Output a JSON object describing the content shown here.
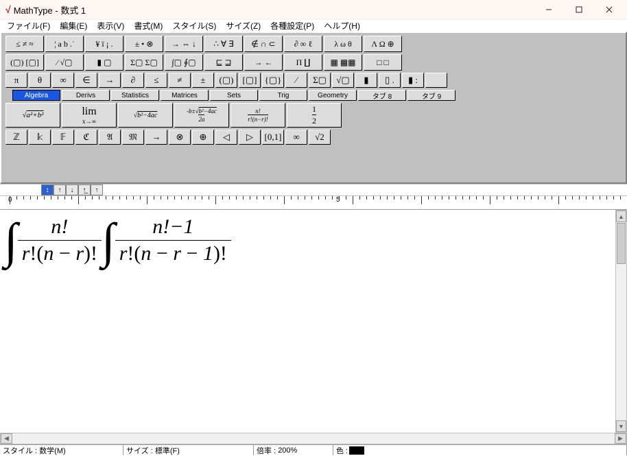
{
  "window": {
    "logo": "√",
    "title": "MathType - 数式 1"
  },
  "menubar": [
    "ファイル(F)",
    "編集(E)",
    "表示(V)",
    "書式(M)",
    "スタイル(S)",
    "サイズ(Z)",
    "各種設定(P)",
    "ヘルプ(H)"
  ],
  "toolbar": {
    "row1": [
      "≤ ≠ ≈",
      "¦ a b .˙",
      "¥ ï ¡ .",
      "± • ⊗",
      "→ ⇔ ↓",
      "∴ ∀ ∃",
      "∉ ∩ ⊂",
      "∂ ∞ ℓ",
      "λ ω θ",
      "Λ Ω ⊕"
    ],
    "row2": [
      "(▢) [▢]",
      "⁄ √▢",
      "▮ ▢",
      "Σ▢ Σ▢",
      "∫▢ ∮▢",
      "⊑ ⊒",
      "→ ←",
      "Π ∐",
      "▦ ▦▦",
      "□ □"
    ],
    "row3": [
      "π",
      "θ",
      "∞",
      "∈",
      "→",
      "∂",
      "≤",
      "≠",
      "±",
      "(▢)",
      "[▢]",
      "{▢}",
      "⁄",
      "Σ▢",
      "√▢",
      "▮",
      "▯ .",
      "▮ :",
      ""
    ],
    "tabs": [
      "Algebra",
      "Derivs",
      "Statistics",
      "Matrices",
      "Sets",
      "Trig",
      "Geometry",
      "タブ 8",
      "タブ 9"
    ],
    "templates": [
      "√(a²+b²)",
      "lim x→∞",
      "√(b²−4ac)",
      "(-b±√(b²−4ac))/2a",
      "n!/(r!(n−r)!)",
      "1/2"
    ],
    "row5": [
      "ℤ",
      "𝕜",
      "𝔽",
      "ℭ",
      "𝔄",
      "𝔐",
      "→",
      "⊗",
      "⊕",
      "◁",
      "▷",
      "[0,1]",
      "∞",
      "√2"
    ]
  },
  "arrows": [
    "↕",
    "↑",
    "↓",
    "↑̲",
    "↑"
  ],
  "ruler": {
    "marks": [
      "0",
      "5"
    ]
  },
  "equation": {
    "term1": {
      "num": "n!",
      "den_l": "r",
      "den_m": "n",
      "den_r": "r"
    },
    "term2": {
      "num": "n!−1",
      "den_l": "r",
      "den_m": "n",
      "den_r": "r",
      "den_extra": "1"
    }
  },
  "status": {
    "style_label": "スタイル :",
    "style_value": "数学(M)",
    "size_label": "サイズ :",
    "size_value": "標準(F)",
    "zoom_label": "倍率 :",
    "zoom_value": "200%",
    "color_label": "色 :"
  }
}
